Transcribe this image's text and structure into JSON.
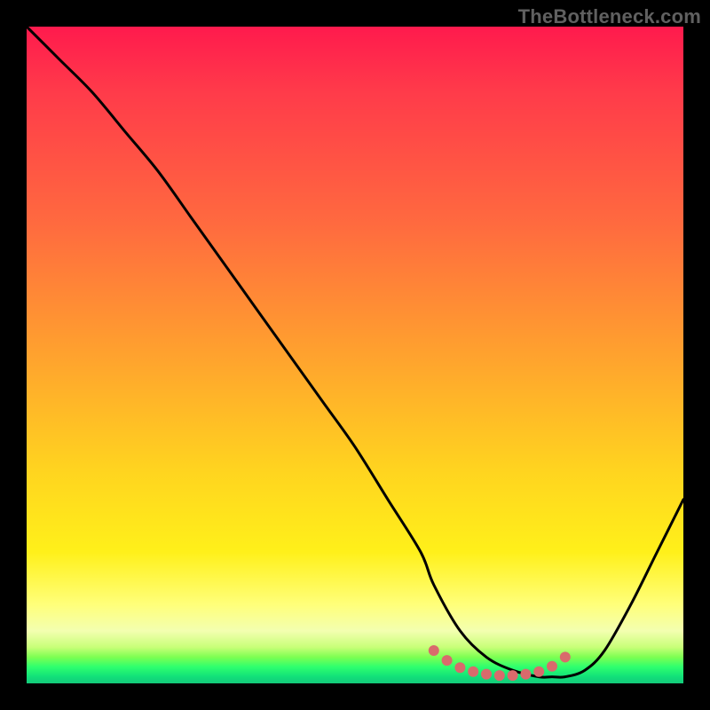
{
  "watermark": "TheBottleneck.com",
  "chart_data": {
    "type": "line",
    "title": "",
    "xlabel": "",
    "ylabel": "",
    "xlim": [
      0,
      100
    ],
    "ylim": [
      0,
      100
    ],
    "series": [
      {
        "name": "main-curve",
        "x": [
          0,
          5,
          10,
          15,
          20,
          25,
          30,
          35,
          40,
          45,
          50,
          55,
          60,
          62,
          66,
          70,
          74,
          78,
          80,
          82,
          85,
          88,
          92,
          96,
          100
        ],
        "values": [
          100,
          95,
          90,
          84,
          78,
          71,
          64,
          57,
          50,
          43,
          36,
          28,
          20,
          15,
          8,
          4,
          2,
          1,
          1,
          1,
          2,
          5,
          12,
          20,
          28
        ]
      }
    ],
    "markers": {
      "name": "bottom-dots",
      "color": "#d96a6c",
      "x": [
        62,
        64,
        66,
        68,
        70,
        72,
        74,
        76,
        78,
        80,
        82
      ],
      "values": [
        5,
        3.5,
        2.4,
        1.8,
        1.4,
        1.2,
        1.2,
        1.4,
        1.8,
        2.6,
        4.0
      ]
    }
  }
}
